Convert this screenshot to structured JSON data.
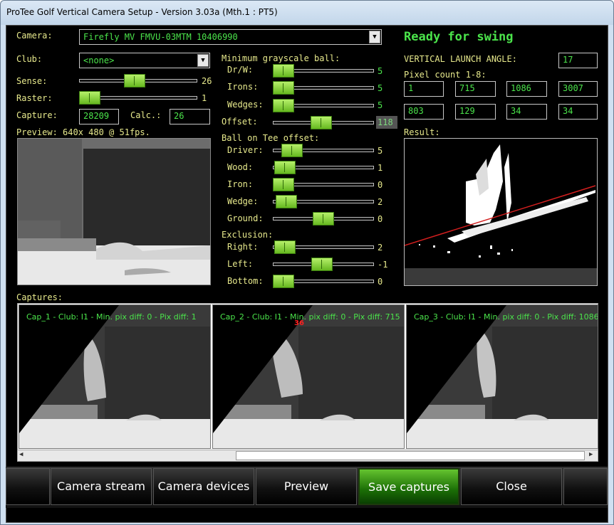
{
  "window": {
    "title": "ProTee Golf Vertical Camera Setup - Version 3.03a (Mth.1 : PT5)"
  },
  "camera": {
    "label": "Camera:",
    "value": "Firefly MV FMVU-03MTM 10406990"
  },
  "status": "Ready for swing",
  "club": {
    "label": "Club:",
    "value": "<none>"
  },
  "sense": {
    "label": "Sense:",
    "value": "26"
  },
  "raster": {
    "label": "Raster:",
    "value": "1"
  },
  "capture": {
    "label": "Capture:",
    "value": "28209",
    "calc_label": "Calc.:",
    "calc_value": "26"
  },
  "preview": {
    "label": "Preview: 640x 480 @ 51fps."
  },
  "min_gray": {
    "label": "Minimum grayscale ball:",
    "items": [
      {
        "label": "Dr/W:",
        "value": "5"
      },
      {
        "label": "Irons:",
        "value": "5"
      },
      {
        "label": "Wedges:",
        "value": "5"
      },
      {
        "label": "Offset:",
        "value": "118"
      }
    ]
  },
  "tee_offset": {
    "label": "Ball on Tee offset:",
    "items": [
      {
        "label": "Driver:",
        "value": "5"
      },
      {
        "label": "Wood:",
        "value": "1"
      },
      {
        "label": "Iron:",
        "value": "0"
      },
      {
        "label": "Wedge:",
        "value": "2"
      },
      {
        "label": "Ground:",
        "value": "0"
      }
    ]
  },
  "exclusion": {
    "label": "Exclusion:",
    "items": [
      {
        "label": "Right:",
        "value": "2"
      },
      {
        "label": "Left:",
        "value": "-1"
      },
      {
        "label": "Bottom:",
        "value": "0"
      }
    ]
  },
  "launch": {
    "label": "VERTICAL LAUNCH ANGLE:",
    "value": "17"
  },
  "pixel": {
    "label": "Pixel count 1-8:",
    "values": [
      "1",
      "715",
      "1086",
      "3007",
      "803",
      "129",
      "34",
      "34"
    ]
  },
  "result": {
    "label": "Result:"
  },
  "captures": {
    "label": "Captures:",
    "items": [
      {
        "text": "Cap_1 - Club: I1 - Min. pix diff: 0 - Pix diff: 1"
      },
      {
        "text": "Cap_2 - Club: I1 - Min. pix diff: 0 - Pix diff: 715",
        "marker": "36"
      },
      {
        "text": "Cap_3 - Club: I1 - Min. pix diff: 0 - Pix diff: 1086"
      }
    ]
  },
  "buttons": {
    "camera_stream": "Camera stream",
    "camera_devices": "Camera devices",
    "preview": "Preview",
    "save": "Save captures",
    "close": "Close"
  },
  "colors": {
    "accent": "#4be44b",
    "label": "#e7e98c",
    "slider": "#7ed33a"
  }
}
